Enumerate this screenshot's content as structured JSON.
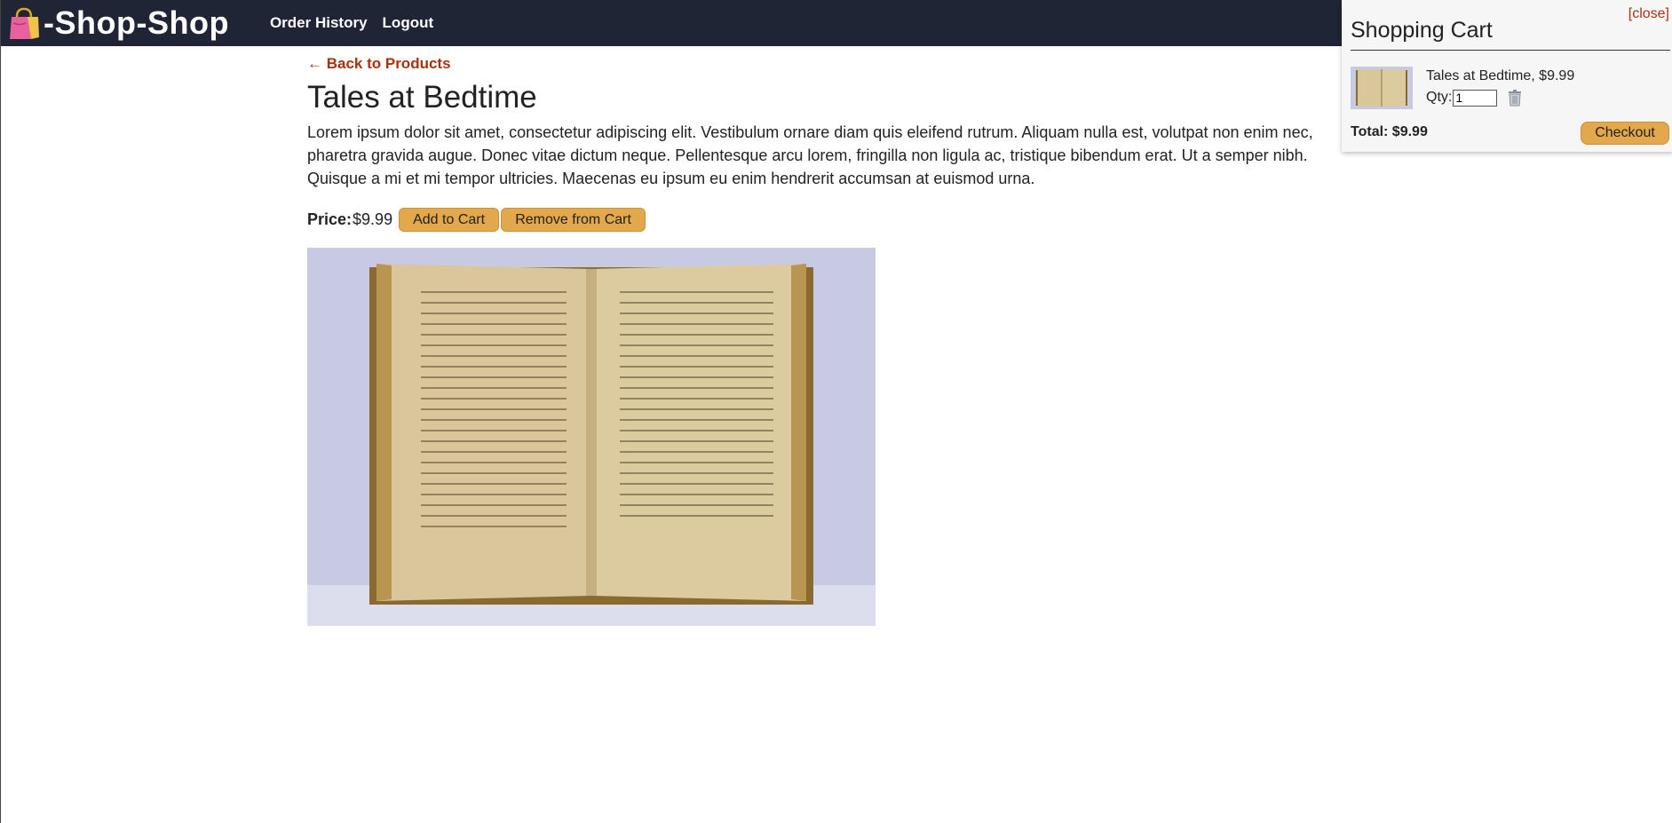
{
  "header": {
    "brand": "-Shop-Shop",
    "brand_icon": "shopping-bag-icon",
    "nav": [
      "Order History",
      "Logout"
    ],
    "background": "#1f2534"
  },
  "product": {
    "back_link": "← Back to Products",
    "name": "Tales at Bedtime",
    "description": "Lorem ipsum dolor sit amet, consectetur adipiscing elit. Vestibulum ornare diam quis eleifend rutrum. Aliquam nulla est, volutpat non enim nec, pharetra gravida augue. Donec vitae dictum neque. Pellentesque arcu lorem, fringilla non ligula ac, tristique bibendum erat. Ut a semper nibh. Quisque a mi et mi tempor ultricies. Maecenas eu ipsum eu enim hendrerit accumsan at euismod urna.",
    "price_label": "Price:",
    "price": "$9.99",
    "add_button": "Add to Cart",
    "remove_button": "Remove from Cart",
    "image": "open-book-photo"
  },
  "cart": {
    "close": "[close]",
    "title": "Shopping Cart",
    "items": [
      {
        "name": "Tales at Bedtime, $9.99",
        "qty_label": "Qty:",
        "qty": "1"
      }
    ],
    "total": "Total: $9.99",
    "checkout": "Checkout"
  },
  "colors": {
    "accent_button": "#e2a84b",
    "link": "#a8320c"
  }
}
